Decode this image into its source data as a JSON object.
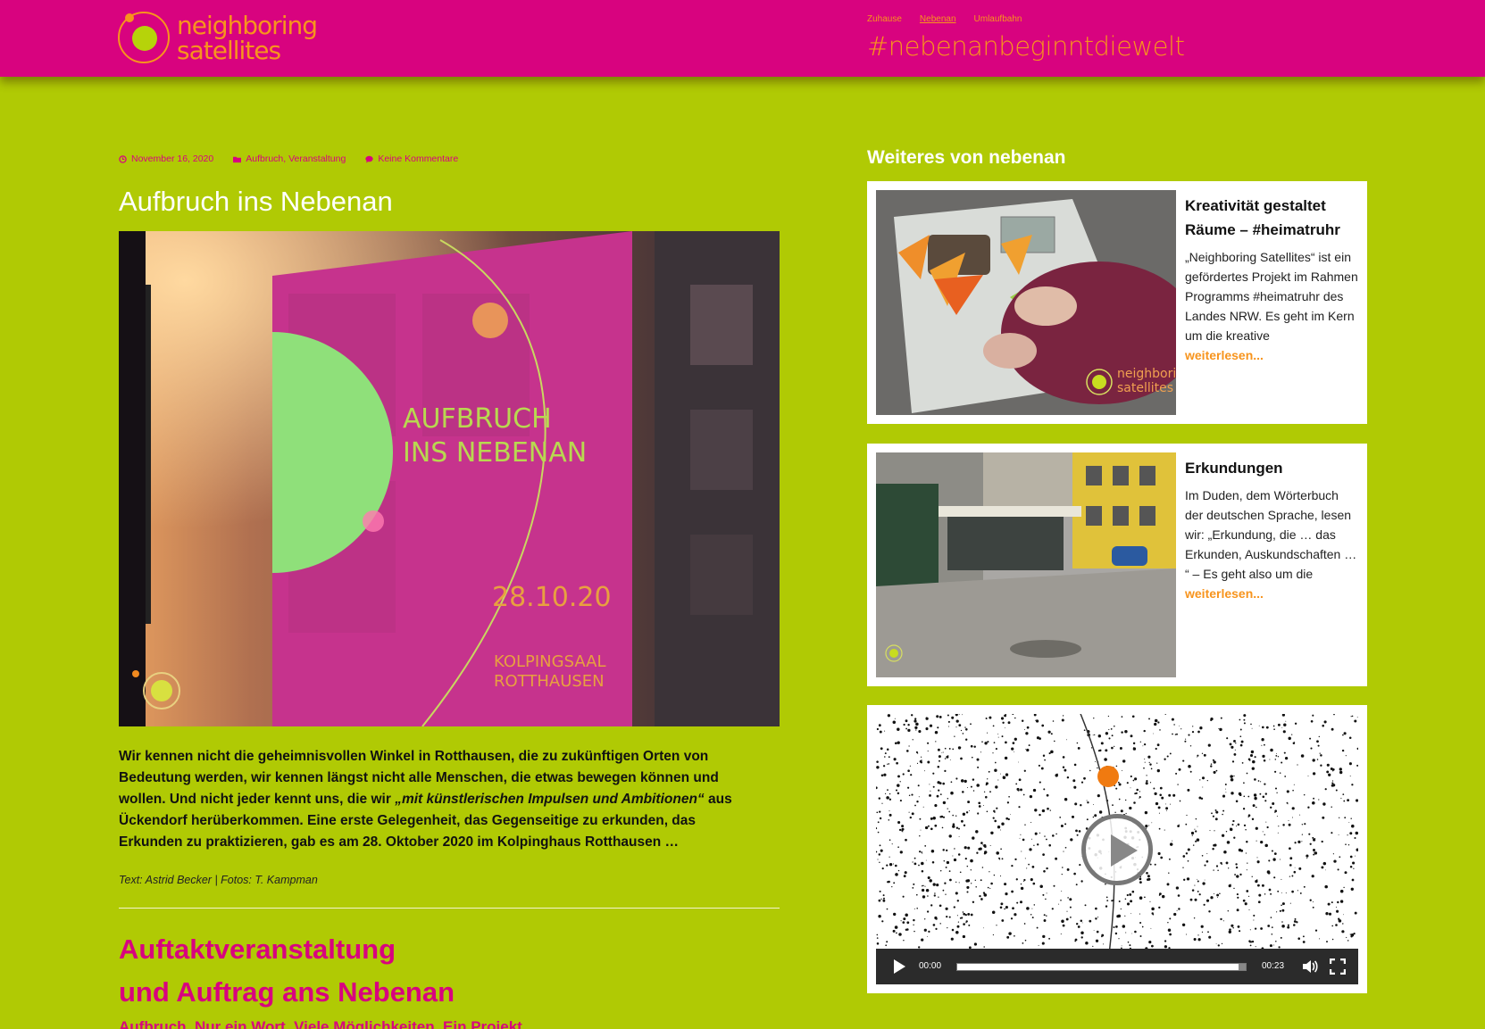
{
  "header": {
    "logo_line1": "neighboring",
    "logo_line2": "satellites",
    "nav": [
      {
        "label": "Zuhause",
        "active": false
      },
      {
        "label": "Nebenan",
        "active": true
      },
      {
        "label": "Umlaufbahn",
        "active": false
      }
    ],
    "tagline": "#nebenanbeginntdiewelt"
  },
  "post": {
    "date": "November 16, 2020",
    "category1": "Aufbruch",
    "category_sep": ", ",
    "category2": "Veranstaltung",
    "comments": "Keine Kommentare",
    "title": "Aufbruch ins Nebenan",
    "hero_poster_line1": "AUFBRUCH",
    "hero_poster_line2": "INS NEBENAN",
    "hero_poster_date": "28.10.20",
    "hero_poster_place1": "KOLPINGSAAL",
    "hero_poster_place2": "ROTTHAUSEN",
    "excerpt_part1": "Wir kennen nicht die geheimnisvollen Winkel in Rotthausen, die zu zukünftigen Orten von Bedeutung werden, wir kennen längst nicht alle Menschen, die etwas bewegen können und wollen. Und nicht jeder kennt uns, die wir ",
    "excerpt_quote": "„mit künstlerischen Impulsen und Ambitionen“",
    "excerpt_part2": " aus Ückendorf herüberkommen. Eine erste Gelegenheit, das Gegenseitige zu erkunden, das Erkunden zu praktizieren, gab es am 28. Oktober 2020 im Kolpinghaus Rotthausen …",
    "credit": "Text: Astrid Becker | Fotos: T. Kampman"
  },
  "next_post": {
    "title_line1": "Auftaktveranstaltung",
    "title_line2": "und Auftrag ans Nebenan",
    "subtitle": "Aufbruch, Nur ein Wort, Viele Möglichkeiten, Ein Projekt"
  },
  "sidebar": {
    "heading": "Weiteres von nebenan",
    "cards": [
      {
        "title": "Kreativität gestaltet Räume – #heimatruhr",
        "text": "„Neighboring Satellites“ ist ein gefördertes Projekt im Rahmen Programms #heimatruhr des Landes NRW. Es geht im Kern um die kreative",
        "more": "weiterlesen...",
        "thumb_logo1": "neighboring",
        "thumb_logo2": "satellites"
      },
      {
        "title": "Erkundungen",
        "text": "Im Duden, dem Wörterbuch der deutschen Sprache, lesen wir: „Erkundung, die … das Erkunden, Auskundschaften … “ – Es geht also um die",
        "more": "weiterlesen..."
      }
    ],
    "video": {
      "current_time": "00:00",
      "duration": "00:23",
      "progress": 0
    }
  },
  "colors": {
    "background": "#b0ca04",
    "header": "#d8037f",
    "accent_orange": "#f7941d",
    "accent_green": "#b6d30a"
  }
}
